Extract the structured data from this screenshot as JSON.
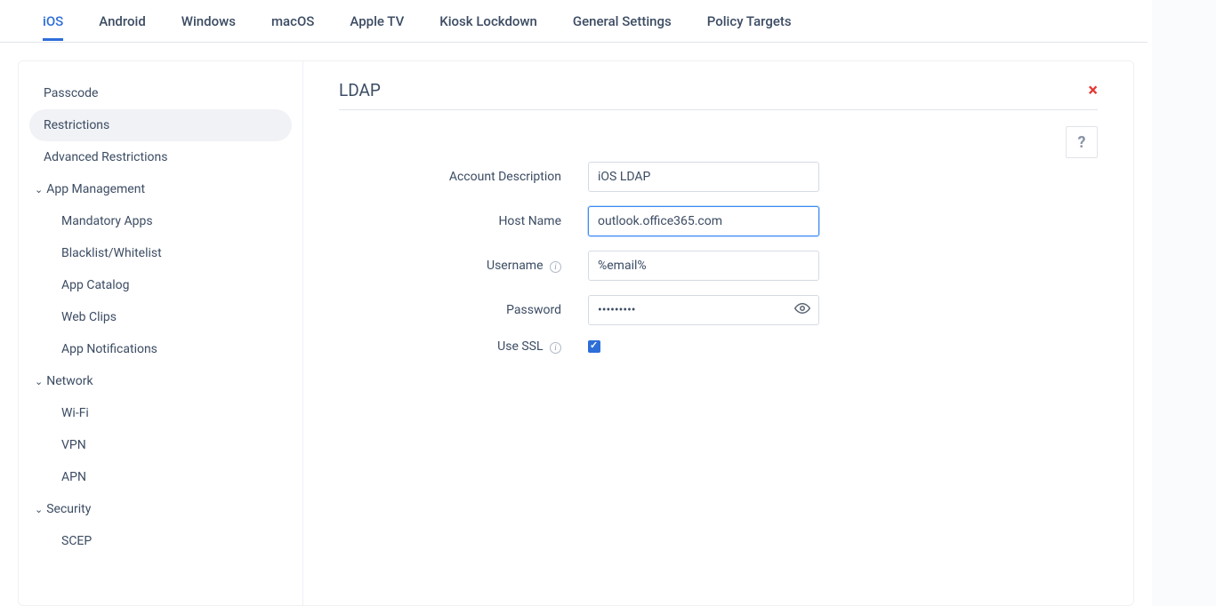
{
  "tabs": {
    "ios": "iOS",
    "android": "Android",
    "windows": "Windows",
    "macos": "macOS",
    "apple_tv": "Apple TV",
    "kiosk": "Kiosk Lockdown",
    "general": "General Settings",
    "policy_targets": "Policy Targets"
  },
  "sidebar": {
    "passcode": "Passcode",
    "restrictions": "Restrictions",
    "advanced_restrictions": "Advanced Restrictions",
    "app_management": "App Management",
    "app_management_items": {
      "mandatory": "Mandatory Apps",
      "blacklist": "Blacklist/Whitelist",
      "catalog": "App Catalog",
      "webclips": "Web Clips",
      "notifications": "App Notifications"
    },
    "network": "Network",
    "network_items": {
      "wifi": "Wi-Fi",
      "vpn": "VPN",
      "apn": "APN"
    },
    "security": "Security",
    "security_items": {
      "scep": "SCEP"
    }
  },
  "content": {
    "title": "LDAP",
    "help": "?",
    "close": "×",
    "labels": {
      "account_description": "Account Description",
      "host_name": "Host Name",
      "username": "Username",
      "password": "Password",
      "use_ssl": "Use SSL"
    },
    "values": {
      "account_description": "iOS LDAP",
      "host_name": "outlook.office365.com",
      "username": "%email%",
      "password": "•••••••••",
      "use_ssl": true
    }
  }
}
